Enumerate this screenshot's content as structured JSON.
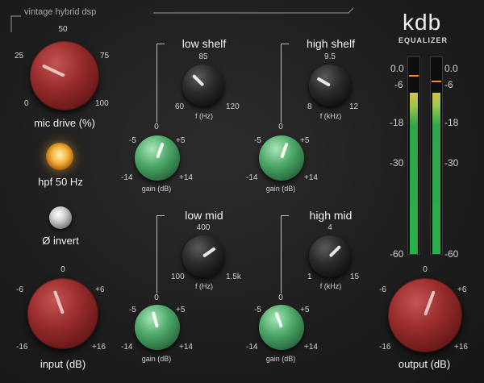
{
  "header": {
    "subtitle": "vintage hybrid dsp"
  },
  "brand": {
    "logo": "kdb",
    "product": "EQUALIZER"
  },
  "mic_drive": {
    "label": "mic drive (%)",
    "ticks": {
      "t0": "0",
      "t25": "25",
      "t50": "50",
      "t75": "75",
      "t100": "100"
    }
  },
  "hpf": {
    "label": "hpf 50 Hz",
    "on": true,
    "lamp_color": "#f5b33a"
  },
  "phase": {
    "label": "Ø invert"
  },
  "input": {
    "label": "input (dB)",
    "ticks": {
      "zero": "0",
      "m6": "-6",
      "p6": "+6",
      "m16": "-16",
      "p16": "+16"
    }
  },
  "output": {
    "label": "output (dB)",
    "ticks": {
      "zero": "0",
      "m6": "-6",
      "p6": "+6",
      "m16": "-16",
      "p16": "+16"
    }
  },
  "bands": {
    "low_shelf": {
      "title": "low shelf",
      "freq_label": "f (Hz)",
      "freq_ticks": {
        "mid": "85",
        "min": "60",
        "max": "120"
      },
      "gain_label": "gain (dB)",
      "gain_ticks": {
        "zero": "0",
        "m5": "-5",
        "p5": "+5",
        "m14": "-14",
        "p14": "+14"
      }
    },
    "high_shelf": {
      "title": "high shelf",
      "freq_label": "f (kHz)",
      "freq_ticks": {
        "mid": "9.5",
        "min": "8",
        "max": "12"
      },
      "gain_label": "gain (dB)",
      "gain_ticks": {
        "zero": "0",
        "m5": "-5",
        "p5": "+5",
        "m14": "-14",
        "p14": "+14"
      }
    },
    "low_mid": {
      "title": "low mid",
      "freq_label": "f (Hz)",
      "freq_ticks": {
        "mid": "400",
        "min": "100",
        "max": "1.5k"
      },
      "gain_label": "gain (dB)",
      "gain_ticks": {
        "zero": "0",
        "m5": "-5",
        "p5": "+5",
        "m14": "-14",
        "p14": "+14"
      }
    },
    "high_mid": {
      "title": "high mid",
      "freq_label": "f (kHz)",
      "freq_ticks": {
        "mid": "4",
        "min": "1",
        "max": "15"
      },
      "gain_label": "gain (dB)",
      "gain_ticks": {
        "zero": "0",
        "m5": "-5",
        "p5": "+5",
        "m14": "-14",
        "p14": "+14"
      }
    }
  },
  "meter": {
    "scale_left": [
      "0.0",
      "-6",
      "-18",
      "-30",
      "-60"
    ],
    "scale_right": [
      "0.0",
      "-6",
      "-18",
      "-30",
      "-60"
    ]
  },
  "colors": {
    "input_knob": "#9b2d2d",
    "gain_knob": "#4ea86a",
    "meter_green": "#2fa64a",
    "peak": "#ff8a1e"
  }
}
